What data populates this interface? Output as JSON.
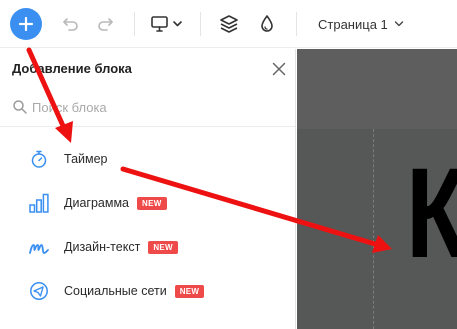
{
  "toolbar": {
    "add_icon": "plus-icon",
    "undo_icon": "undo-icon",
    "redo_icon": "redo-icon",
    "device_icon": "monitor-icon",
    "layers_icon": "layers-icon",
    "theme_icon": "drop-icon",
    "page_label": "Страница 1"
  },
  "panel": {
    "title": "Добавление блока",
    "search_placeholder": "Поиск блока",
    "items": [
      {
        "label": "Таймер",
        "icon": "stopwatch-icon",
        "badge": ""
      },
      {
        "label": "Диаграмма",
        "icon": "bar-chart-icon",
        "badge": "NEW"
      },
      {
        "label": "Дизайн-текст",
        "icon": "design-text-icon",
        "badge": "NEW"
      },
      {
        "label": "Социальные сети",
        "icon": "send-icon",
        "badge": "NEW"
      }
    ]
  },
  "canvas": {
    "big_text": "К"
  },
  "colors": {
    "accent": "#3a8ff0",
    "badge": "#ef4a4a",
    "arrow": "#ee1111",
    "canvas": "#565858"
  }
}
